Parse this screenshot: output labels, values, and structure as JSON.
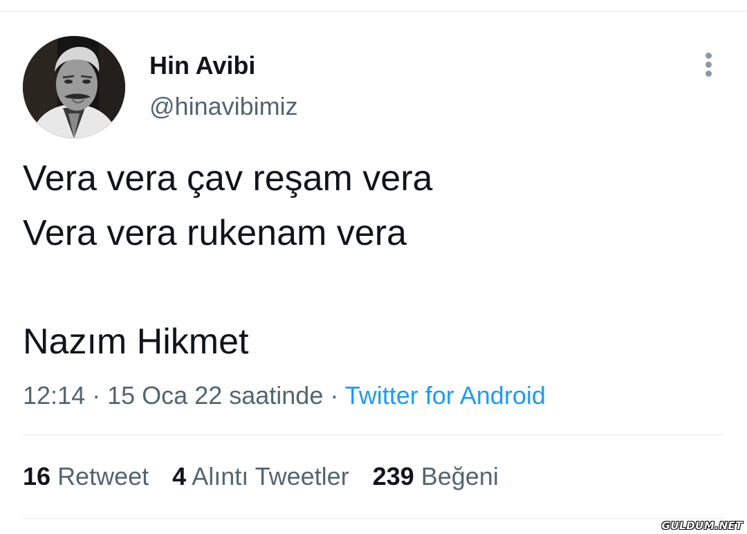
{
  "tweet": {
    "author": {
      "display_name": "Hin Avibi",
      "handle": "@hinavibimiz",
      "avatar": "avatar-photo"
    },
    "more_icon": "more-vertical-icon",
    "text_lines": [
      "Vera vera çav reşam vera",
      "Vera vera rukenam vera",
      "Nazım Hikmet"
    ],
    "meta": {
      "time": "12:14",
      "date": "15 Oca 22 saatinde",
      "separator": "·",
      "source": "Twitter for Android"
    },
    "stats": {
      "retweets": {
        "count": "16",
        "label": "Retweet"
      },
      "quotes": {
        "count": "4",
        "label": "Alıntı Tweetler"
      },
      "likes": {
        "count": "239",
        "label": "Beğeni"
      }
    }
  },
  "watermark": "GULDUM.NET",
  "colors": {
    "text_primary": "#0f1419",
    "text_secondary": "#536471",
    "link": "#1d9bf0",
    "divider": "#e6e9ec",
    "icon": "#8b98a5"
  }
}
